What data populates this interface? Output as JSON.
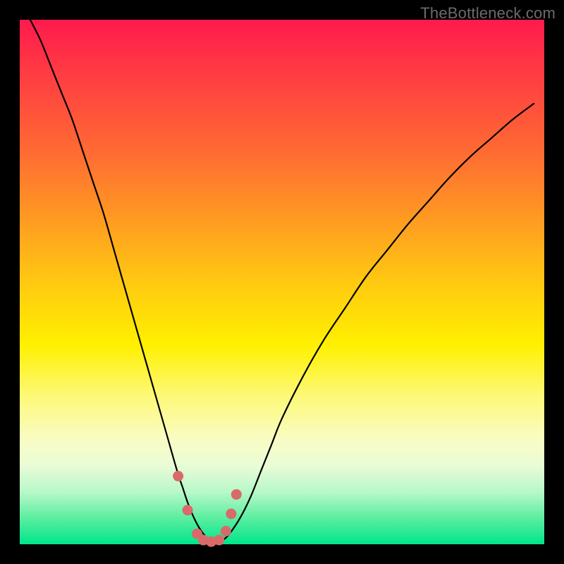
{
  "watermark": "TheBottleneck.com",
  "chart_data": {
    "type": "line",
    "title": "",
    "xlabel": "",
    "ylabel": "",
    "xlim": [
      0,
      100
    ],
    "ylim": [
      0,
      100
    ],
    "x": [
      2,
      4,
      6,
      8,
      10,
      12,
      14,
      16,
      18,
      20,
      22,
      24,
      26,
      28,
      30,
      31,
      32,
      33,
      34,
      35,
      36,
      37,
      38,
      39,
      40,
      42,
      44,
      46,
      48,
      50,
      54,
      58,
      62,
      66,
      70,
      74,
      78,
      82,
      86,
      90,
      94,
      98
    ],
    "values": [
      100,
      96,
      91,
      86,
      81,
      75,
      69,
      63,
      56,
      49,
      42,
      35,
      28,
      21,
      14,
      11,
      8,
      5.5,
      3.5,
      2,
      1,
      0.5,
      0.5,
      1,
      2,
      5,
      9,
      14,
      19,
      24,
      32,
      39,
      45,
      51,
      56,
      61,
      65.5,
      70,
      74,
      77.5,
      81,
      84
    ],
    "markers": {
      "x": [
        30.2,
        32.0,
        33.8,
        35.0,
        36.5,
        38.0,
        39.3,
        40.3,
        41.3
      ],
      "y": [
        13.0,
        6.5,
        2.0,
        0.8,
        0.5,
        0.8,
        2.5,
        5.8,
        9.5
      ]
    },
    "gradient_stops": [
      {
        "pos": 0,
        "color": "#ff1a4d"
      },
      {
        "pos": 50,
        "color": "#fff000"
      },
      {
        "pos": 100,
        "color": "#00e58a"
      }
    ]
  }
}
